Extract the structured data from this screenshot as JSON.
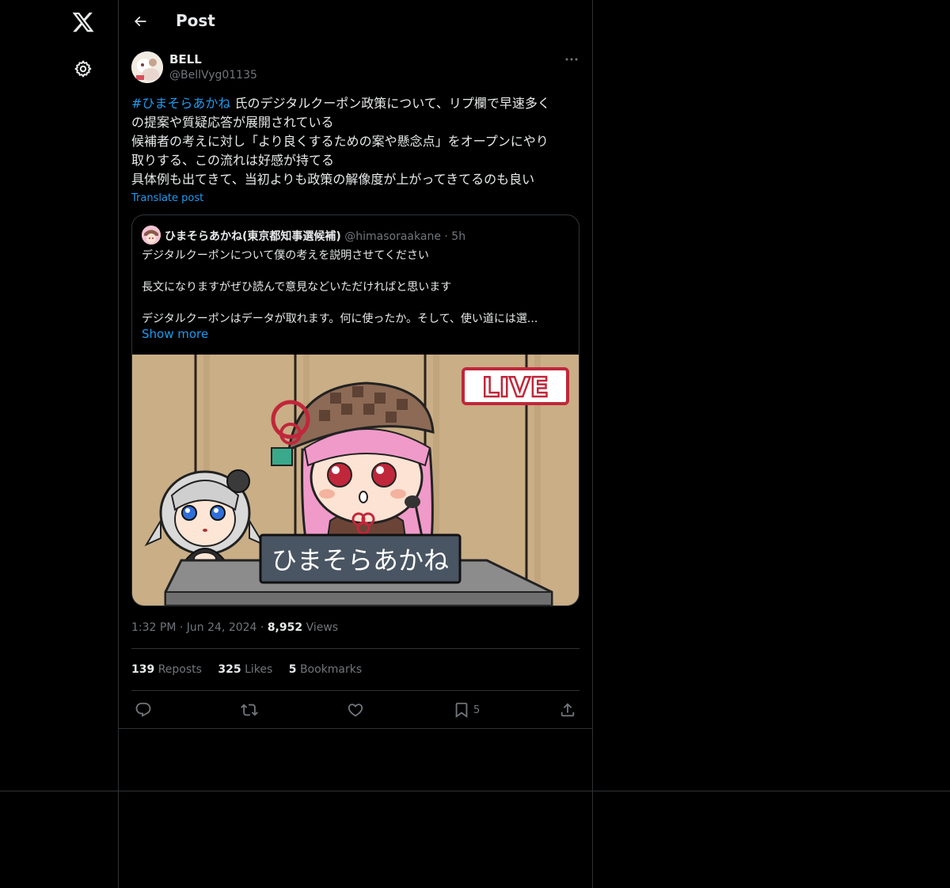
{
  "header": {
    "title": "Post"
  },
  "author": {
    "name": "BELL",
    "handle": "@BellVyg01135"
  },
  "post": {
    "hashtag": "#ひまそらあかね",
    "line1_rest": " 氏のデジタルクーポン政策について、リプ欄で早速多く",
    "line2": "の提案や質疑応答が展開されている",
    "line3": "候補者の考えに対し「より良くするための案や懸念点」をオープンにやり",
    "line4": "取りする、この流れは好感が持てる",
    "line5": "具体例も出てきて、当初よりも政策の解像度が上がってきてるのも良い",
    "translate_label": "Translate post"
  },
  "quote": {
    "name": "ひまそらあかね(東京都知事選候補)",
    "handle": "@himasoraakane",
    "dot": "·",
    "time": "5h",
    "p1": "デジタルクーポンについて僕の考えを説明させてください",
    "p2": "長文になりますがぜひ読んで意見などいただければと思います",
    "p3": "デジタルクーポンはデータが取れます。何に使ったか。そして、使い道には選...",
    "show_more": "Show more",
    "media": {
      "live_label": "LIVE",
      "nameplate": "ひまそらあかね"
    }
  },
  "meta": {
    "time": "1:32 PM",
    "dot": "·",
    "date": "Jun 24, 2024",
    "views_count": "8,952",
    "views_label": "Views"
  },
  "stats": {
    "reposts_count": "139",
    "reposts_label": "Reposts",
    "likes_count": "325",
    "likes_label": "Likes",
    "bookmarks_count": "5",
    "bookmarks_label": "Bookmarks"
  },
  "actions": {
    "bookmark_count": "5"
  },
  "icons": [
    "x-logo-icon",
    "gear-icon",
    "back-arrow-icon",
    "more-icon",
    "reply-icon",
    "repost-icon",
    "like-icon",
    "bookmark-icon",
    "share-icon"
  ],
  "colors": {
    "background": "#000000",
    "text": "#e7e9ea",
    "muted": "#71767b",
    "accent": "#1d9bf0",
    "border": "#2f3336"
  }
}
